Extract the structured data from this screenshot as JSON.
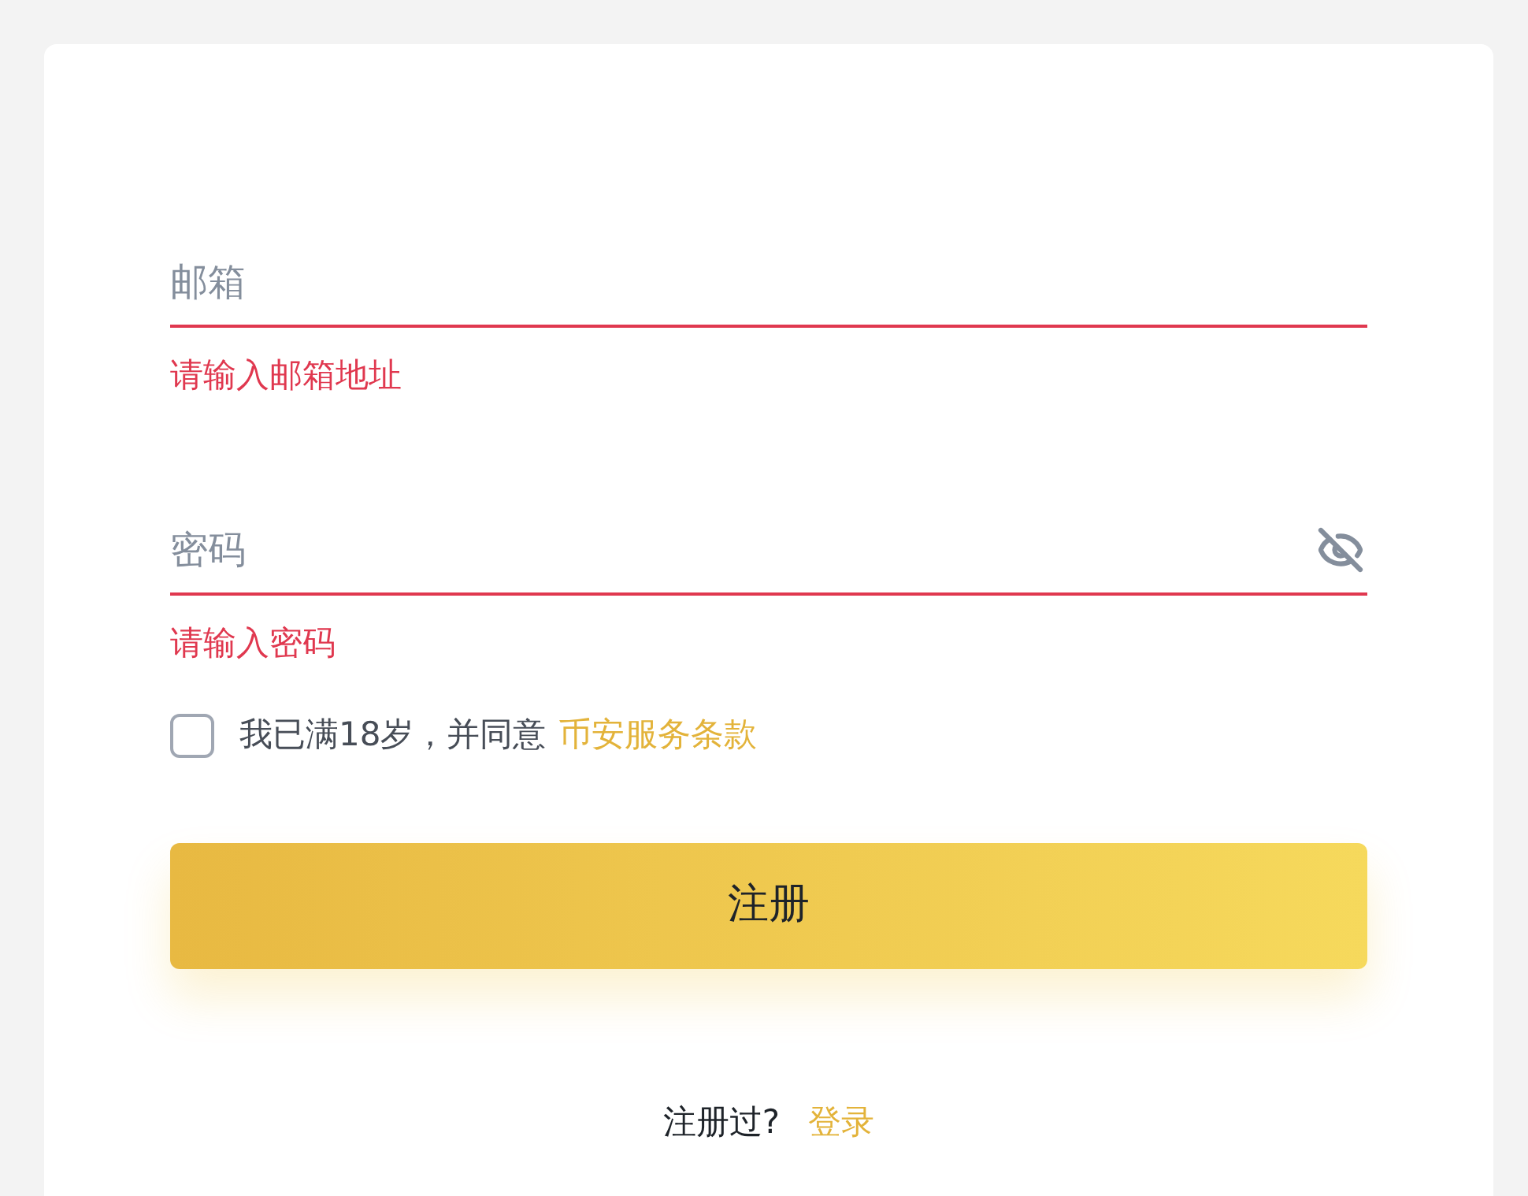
{
  "fields": [
    {
      "kind": "email",
      "placeholder": "邮箱",
      "error": "请输入邮箱地址"
    },
    {
      "kind": "password",
      "placeholder": "密码",
      "error": "请输入密码",
      "password_visible": false
    }
  ],
  "agreement": {
    "checked": false,
    "text": "我已满18岁，并同意",
    "link": "币安服务条款"
  },
  "submit": {
    "label": "注册"
  },
  "footer": {
    "text": "注册过?",
    "link": "登录"
  }
}
